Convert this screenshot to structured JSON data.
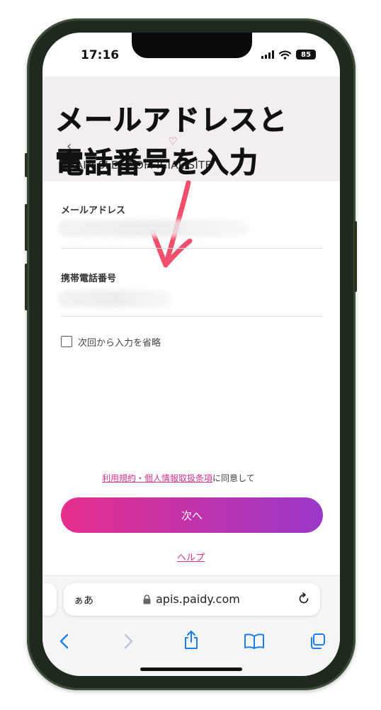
{
  "overlay": {
    "line1": "メールアドレスと",
    "line2": "電話番号を入力"
  },
  "status_bar": {
    "time": "17:16",
    "battery": "85"
  },
  "header": {
    "site_name": "BRAIN SLEEP OFFICIAL SITE"
  },
  "form": {
    "email_label": "メールアドレス",
    "phone_label": "携帯電話番号",
    "remember_label": "次回から入力を省略",
    "terms_link": "利用規約・個人情報取扱条項",
    "terms_suffix": "に同意して",
    "next_button": "次へ",
    "help_link": "ヘルプ"
  },
  "browser": {
    "aa_label": "ぁあ",
    "url": "apis.paidy.com"
  },
  "colors": {
    "accent": "#d8338f",
    "button_start": "#e62e8c",
    "button_end": "#9b38c9",
    "arrow": "#f0506b",
    "ios_blue": "#1a7ef0"
  }
}
